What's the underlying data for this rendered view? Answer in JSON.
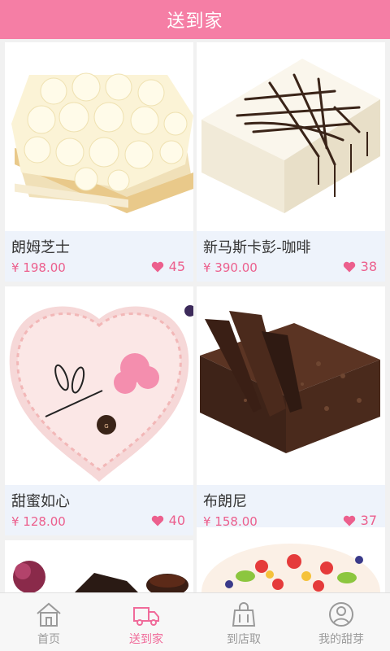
{
  "header": {
    "title": "送到家"
  },
  "products": [
    {
      "name": "朗姆芝士",
      "price": "¥ 198.00",
      "likes": "45"
    },
    {
      "name": "新马斯卡彭-咖啡",
      "price": "¥ 390.00",
      "likes": "38"
    },
    {
      "name": "甜蜜如心",
      "price": "¥ 128.00",
      "likes": "40"
    },
    {
      "name": "布朗尼",
      "price": "¥ 158.00",
      "likes": "37"
    }
  ],
  "tabs": [
    {
      "label": "首页",
      "icon": "home-icon"
    },
    {
      "label": "送到家",
      "icon": "delivery-truck-icon"
    },
    {
      "label": "到店取",
      "icon": "shopping-bag-icon"
    },
    {
      "label": "我的甜芽",
      "icon": "user-icon"
    }
  ],
  "colors": {
    "accent": "#f57ea5",
    "price": "#ec5f8d",
    "info_bg": "#eef3fb",
    "tab_inactive": "#9a9a9a"
  }
}
